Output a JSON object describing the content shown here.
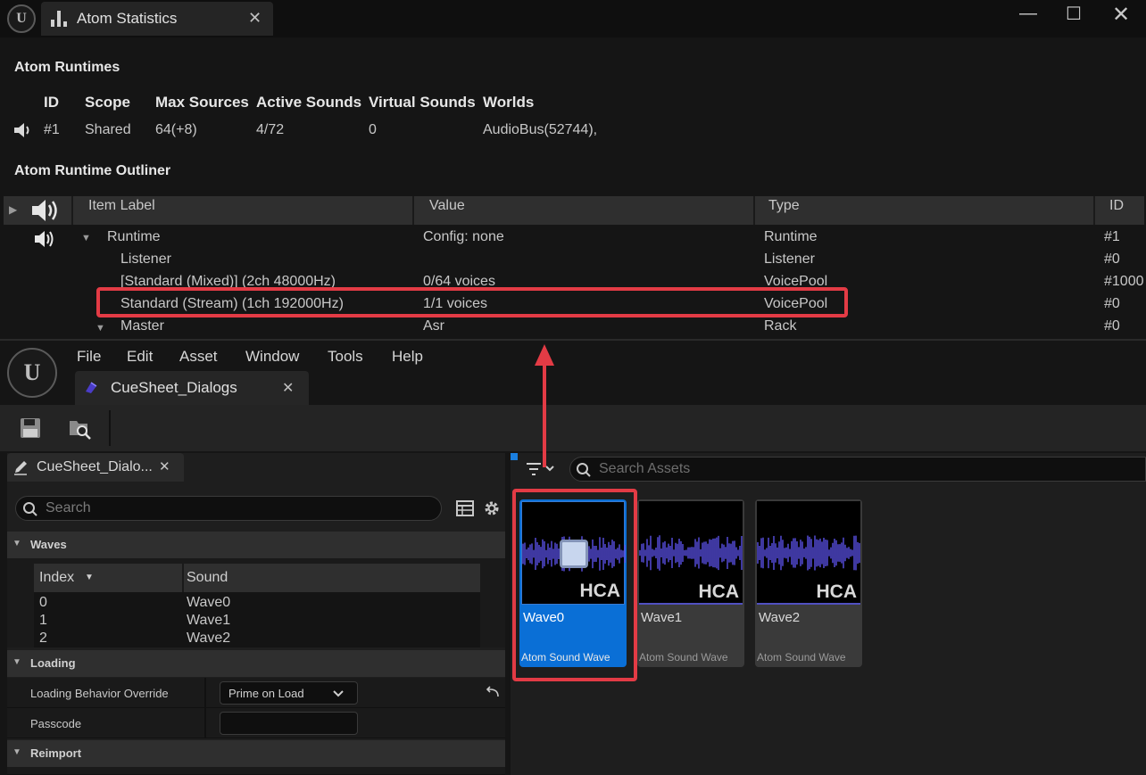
{
  "stats_window": {
    "tab_title": "Atom Statistics",
    "runtimes_heading": "Atom Runtimes",
    "runtimes_columns": [
      "ID",
      "Scope",
      "Max Sources",
      "Active Sounds",
      "Virtual Sounds",
      "Worlds"
    ],
    "runtimes_row": {
      "id": "#1",
      "scope": "Shared",
      "max_sources": "64(+8)",
      "active_sounds": "4/72",
      "virtual_sounds": "0",
      "worlds": "AudioBus(52744),"
    },
    "outliner_heading": "Atom Runtime Outliner",
    "outliner_columns": {
      "item_label": "Item Label",
      "value": "Value",
      "type": "Type",
      "id": "ID"
    },
    "outliner_rows": [
      {
        "label": "Runtime",
        "value": "Config: none",
        "type": "Runtime",
        "id": "#1"
      },
      {
        "label": "Listener",
        "value": "",
        "type": "Listener",
        "id": "#0"
      },
      {
        "label": "[Standard (Mixed)]  (2ch 48000Hz)",
        "value": "0/64 voices",
        "type": "VoicePool",
        "id": "#1000"
      },
      {
        "label": "Standard (Stream)  (1ch 192000Hz)",
        "value": "1/1 voices",
        "type": "VoicePool",
        "id": "#0"
      },
      {
        "label": "Master",
        "value": "Asr",
        "type": "Rack",
        "id": "#0"
      }
    ]
  },
  "editor": {
    "menu": [
      "File",
      "Edit",
      "Asset",
      "Window",
      "Tools",
      "Help"
    ],
    "doc_tab": "CueSheet_Dialogs",
    "details": {
      "tab": "CueSheet_Dialo...",
      "search_placeholder": "Search",
      "waves_category": "Waves",
      "waves_columns": {
        "index": "Index",
        "sound": "Sound"
      },
      "waves_rows": [
        {
          "index": "0",
          "sound": "Wave0"
        },
        {
          "index": "1",
          "sound": "Wave1"
        },
        {
          "index": "2",
          "sound": "Wave2"
        }
      ],
      "loading_category": "Loading",
      "loading_behavior_label": "Loading Behavior Override",
      "loading_behavior_value": "Prime on Load",
      "passcode_label": "Passcode",
      "passcode_value": "",
      "reimport_category": "Reimport"
    },
    "content": {
      "search_placeholder": "Search Assets",
      "assets": [
        {
          "name": "Wave0",
          "type": "Atom Sound Wave",
          "badge": "HCA"
        },
        {
          "name": "Wave1",
          "type": "Atom Sound Wave",
          "badge": "HCA"
        },
        {
          "name": "Wave2",
          "type": "Atom Sound Wave",
          "badge": "HCA"
        }
      ]
    }
  },
  "colors": {
    "highlight": "#e33b45",
    "selected": "#0a6fd6",
    "waveform": "#5a50e6"
  }
}
